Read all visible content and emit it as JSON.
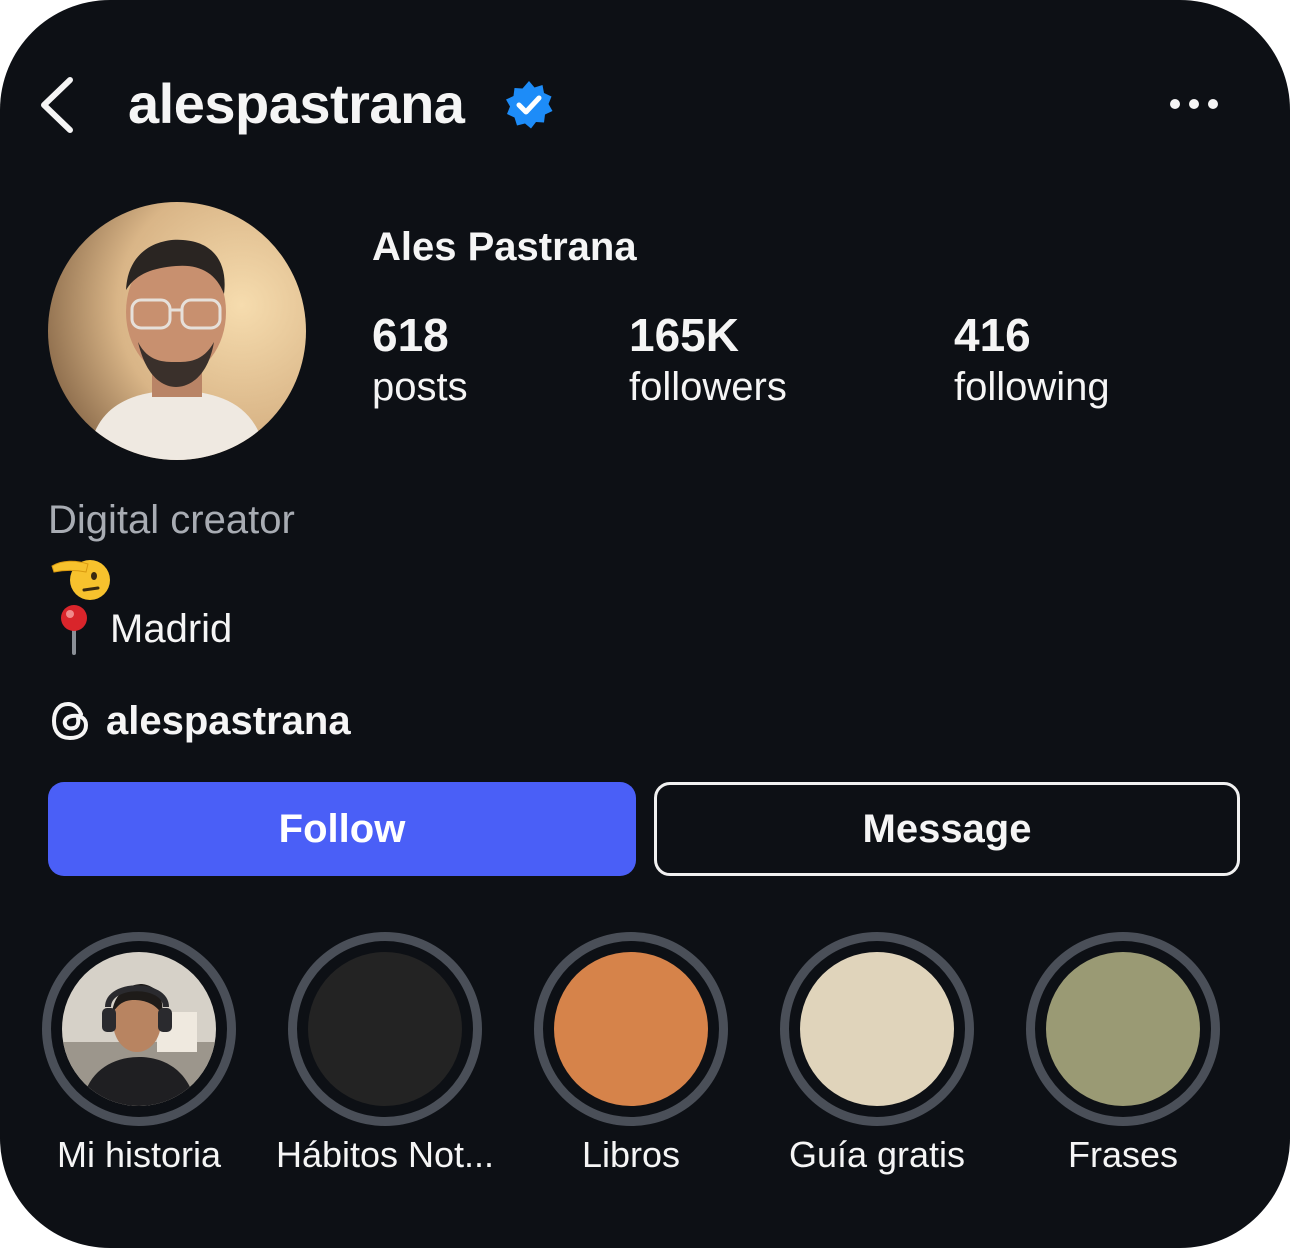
{
  "header": {
    "username": "alespastrana",
    "verified": true,
    "back_icon": "chevron-left-icon",
    "more_icon": "more-horizontal-icon",
    "verified_color": "#1d8cf8"
  },
  "profile": {
    "display_name": "Ales Pastrana",
    "stats": [
      {
        "value": "618",
        "label": "posts"
      },
      {
        "value": "165K",
        "label": "followers"
      },
      {
        "value": "416",
        "label": "following"
      }
    ],
    "category": "Digital creator",
    "bio_emoji": "saluting-face",
    "location": "Madrid",
    "threads_handle": "alespastrana"
  },
  "actions": {
    "follow_label": "Follow",
    "message_label": "Message",
    "follow_color": "#4a5ff7"
  },
  "highlights": [
    {
      "label": "Mi historia",
      "color": "photo"
    },
    {
      "label": "Hábitos Not...",
      "color": "#232323"
    },
    {
      "label": "Libros",
      "color": "#d6834a"
    },
    {
      "label": "Guía gratis",
      "color": "#e0d4bb"
    },
    {
      "label": "Frases",
      "color": "#9a9a74"
    }
  ]
}
